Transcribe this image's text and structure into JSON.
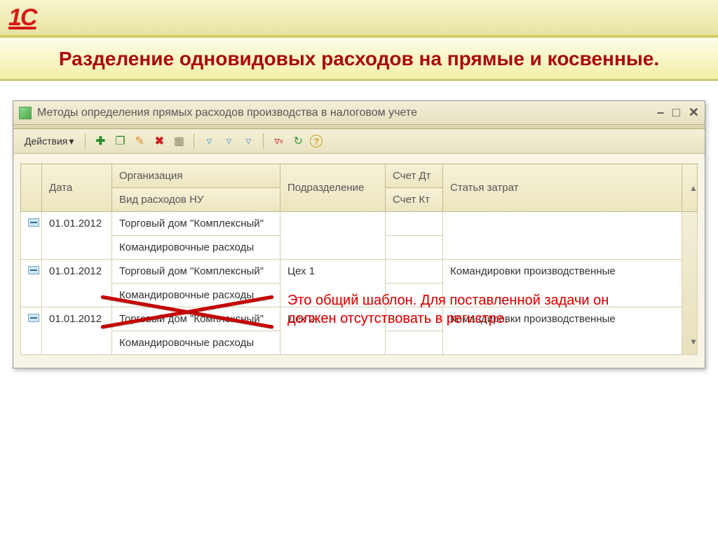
{
  "header": {
    "logo": "1C"
  },
  "slide": {
    "title": "Разделение одновидовых расходов на прямые и косвенные."
  },
  "window": {
    "title": "Методы определения прямых расходов производства в налоговом учете"
  },
  "toolbar": {
    "actions_label": "Действия"
  },
  "table": {
    "headers": {
      "date": "Дата",
      "org": "Организация",
      "expense_type": "Вид расходов НУ",
      "department": "Подразделение",
      "acc_dt": "Счет Дт",
      "acc_kt": "Счет Кт",
      "cost_item": "Статья затрат"
    },
    "rows": [
      {
        "date": "01.01.2012",
        "org": "Торговый дом \"Комплексный\"",
        "expense_type": "Командировочные расходы",
        "department": "",
        "acc_dt": "",
        "acc_kt": "",
        "cost_item": ""
      },
      {
        "date": "01.01.2012",
        "org": "Торговый дом \"Комплексный\"",
        "expense_type": "Командировочные расходы",
        "department": "Цех 1",
        "acc_dt": "",
        "acc_kt": "",
        "cost_item": "Командировки производственные"
      },
      {
        "date": "01.01.2012",
        "org": "Торговый дом \"Комплексный\"",
        "expense_type": "Командировочные расходы",
        "department": "Цех 2",
        "acc_dt": "",
        "acc_kt": "",
        "cost_item": "Командировки производственные"
      }
    ]
  },
  "annotation": {
    "text": "Это общий шаблон. Для поставленной задачи он должен отсутствовать в регистре."
  }
}
